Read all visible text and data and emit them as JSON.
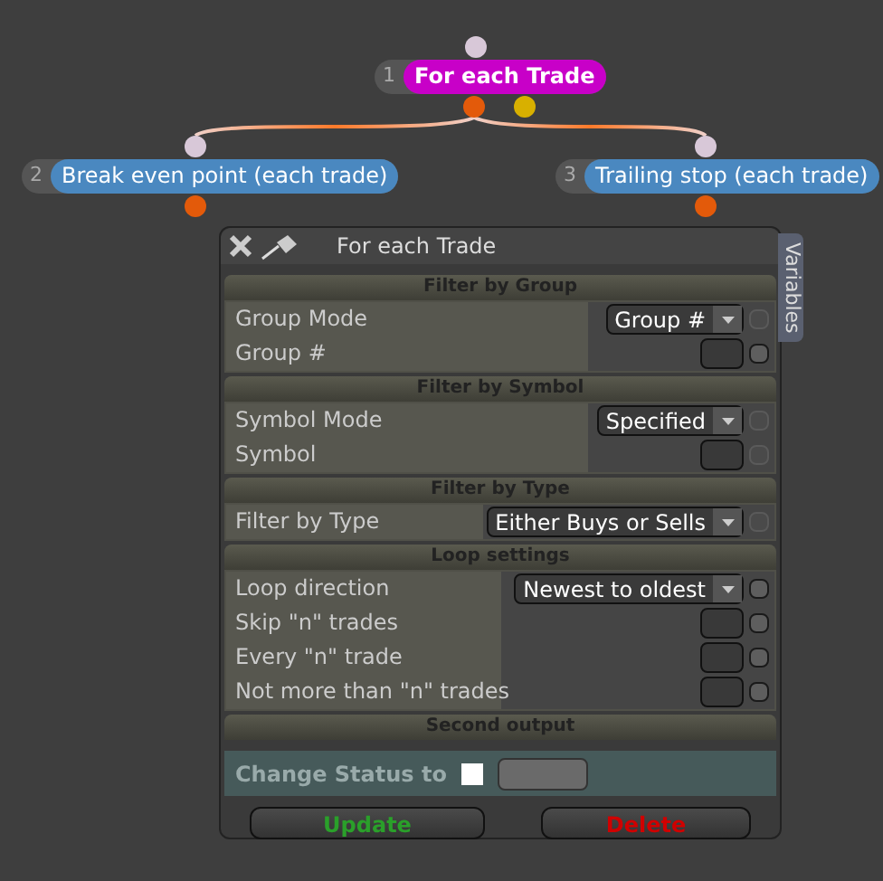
{
  "nodes": [
    {
      "number": "1",
      "label": "For each Trade",
      "color": "#c800c8"
    },
    {
      "number": "2",
      "label": "Break even point (each trade)",
      "color": "#4a88c0"
    },
    {
      "number": "3",
      "label": "Trailing stop (each trade)",
      "color": "#4a88c0"
    }
  ],
  "panel": {
    "title": "For each Trade",
    "side_tab": "Variables",
    "sections": [
      {
        "title": "Filter by Group",
        "rows": [
          {
            "label": "Group Mode",
            "control": {
              "kind": "select",
              "value": "Group #"
            },
            "checkbox_enabled": false
          },
          {
            "label": "Group #",
            "control": {
              "kind": "input"
            },
            "checkbox_enabled": true
          }
        ]
      },
      {
        "title": "Filter by Symbol",
        "rows": [
          {
            "label": "Symbol Mode",
            "control": {
              "kind": "select",
              "value": "Specified"
            },
            "checkbox_enabled": false
          },
          {
            "label": "Symbol",
            "control": {
              "kind": "input"
            },
            "checkbox_enabled": false
          }
        ]
      },
      {
        "title": "Filter by Type",
        "rows": [
          {
            "label": "Filter by Type",
            "control": {
              "kind": "select",
              "value": "Either Buys or Sells"
            },
            "checkbox_enabled": false
          }
        ]
      },
      {
        "title": "Loop settings",
        "rows": [
          {
            "label": "Loop direction",
            "control": {
              "kind": "select",
              "value": "Newest to oldest"
            },
            "checkbox_enabled": true
          },
          {
            "label": "Skip \"n\" trades",
            "control": {
              "kind": "input"
            },
            "checkbox_enabled": true
          },
          {
            "label": "Every \"n\" trade",
            "control": {
              "kind": "input"
            },
            "checkbox_enabled": true
          },
          {
            "label": "Not more than \"n\" trades",
            "control": {
              "kind": "input"
            },
            "checkbox_enabled": true
          }
        ]
      }
    ],
    "second_output": {
      "title": "Second output",
      "label": "Change Status to",
      "checked": false
    },
    "buttons": [
      {
        "label": "Update",
        "color": "#2aa02a"
      },
      {
        "label": "Delete",
        "color": "#d00000"
      }
    ]
  }
}
